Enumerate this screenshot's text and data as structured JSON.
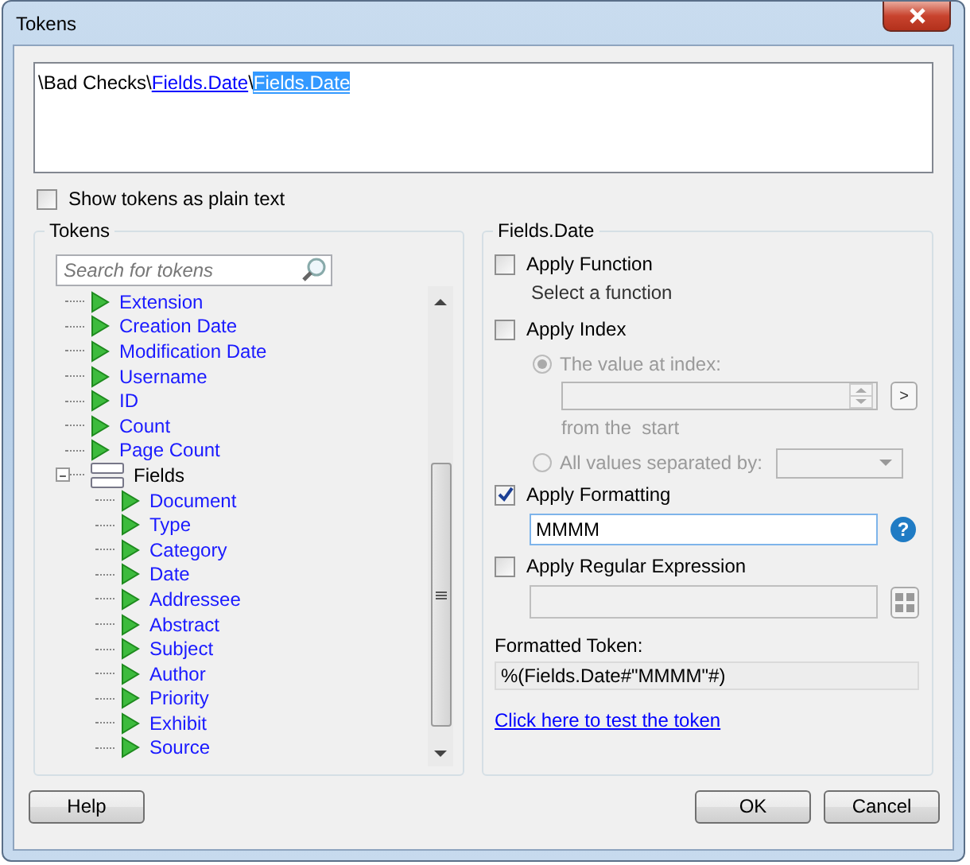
{
  "window": {
    "title": "Tokens"
  },
  "path": [
    {
      "kind": "plain",
      "text": "\\Bad Checks\\"
    },
    {
      "kind": "link",
      "text": "Fields.Date"
    },
    {
      "kind": "plain",
      "text": "\\"
    },
    {
      "kind": "selected",
      "text": "Fields.Date"
    }
  ],
  "plain_text_option": {
    "label": "Show tokens as plain text",
    "checked": false
  },
  "tokens_panel": {
    "title": "Tokens",
    "search": {
      "placeholder": "Search for tokens"
    },
    "tree": [
      {
        "label": "Extension"
      },
      {
        "label": "Creation Date"
      },
      {
        "label": "Modification Date"
      },
      {
        "label": "Username"
      },
      {
        "label": "ID"
      },
      {
        "label": "Count"
      },
      {
        "label": "Page Count"
      },
      {
        "label": "Fields",
        "expanded": true,
        "children": [
          {
            "label": "Document"
          },
          {
            "label": "Type"
          },
          {
            "label": "Category"
          },
          {
            "label": "Date"
          },
          {
            "label": "Addressee"
          },
          {
            "label": "Abstract"
          },
          {
            "label": "Subject"
          },
          {
            "label": "Author"
          },
          {
            "label": "Priority"
          },
          {
            "label": "Exhibit"
          },
          {
            "label": "Source"
          }
        ]
      }
    ]
  },
  "options_panel": {
    "title": "Fields.Date",
    "apply_function": {
      "label": "Apply Function",
      "checked": false,
      "hint": "Select a function"
    },
    "apply_index": {
      "label": "Apply Index",
      "checked": false,
      "radios": [
        {
          "label": "The value at index:",
          "selected": true
        },
        {
          "label": "All values separated by:",
          "selected": false
        }
      ],
      "next_button": ">",
      "from_label": "from the  start"
    },
    "apply_formatting": {
      "label": "Apply Formatting",
      "checked": true,
      "value": "MMMM",
      "help_button": "?"
    },
    "apply_regex": {
      "label": "Apply Regular Expression",
      "checked": false
    },
    "formatted_token": {
      "label": "Formatted Token:",
      "value": "%(Fields.Date#\"MMMM\"#)"
    },
    "test_link": "Click here to test the token"
  },
  "buttons": [
    {
      "kind": "help",
      "label": "Help"
    },
    {
      "kind": "ok",
      "label": "OK"
    },
    {
      "kind": "cancel",
      "label": "Cancel"
    }
  ]
}
